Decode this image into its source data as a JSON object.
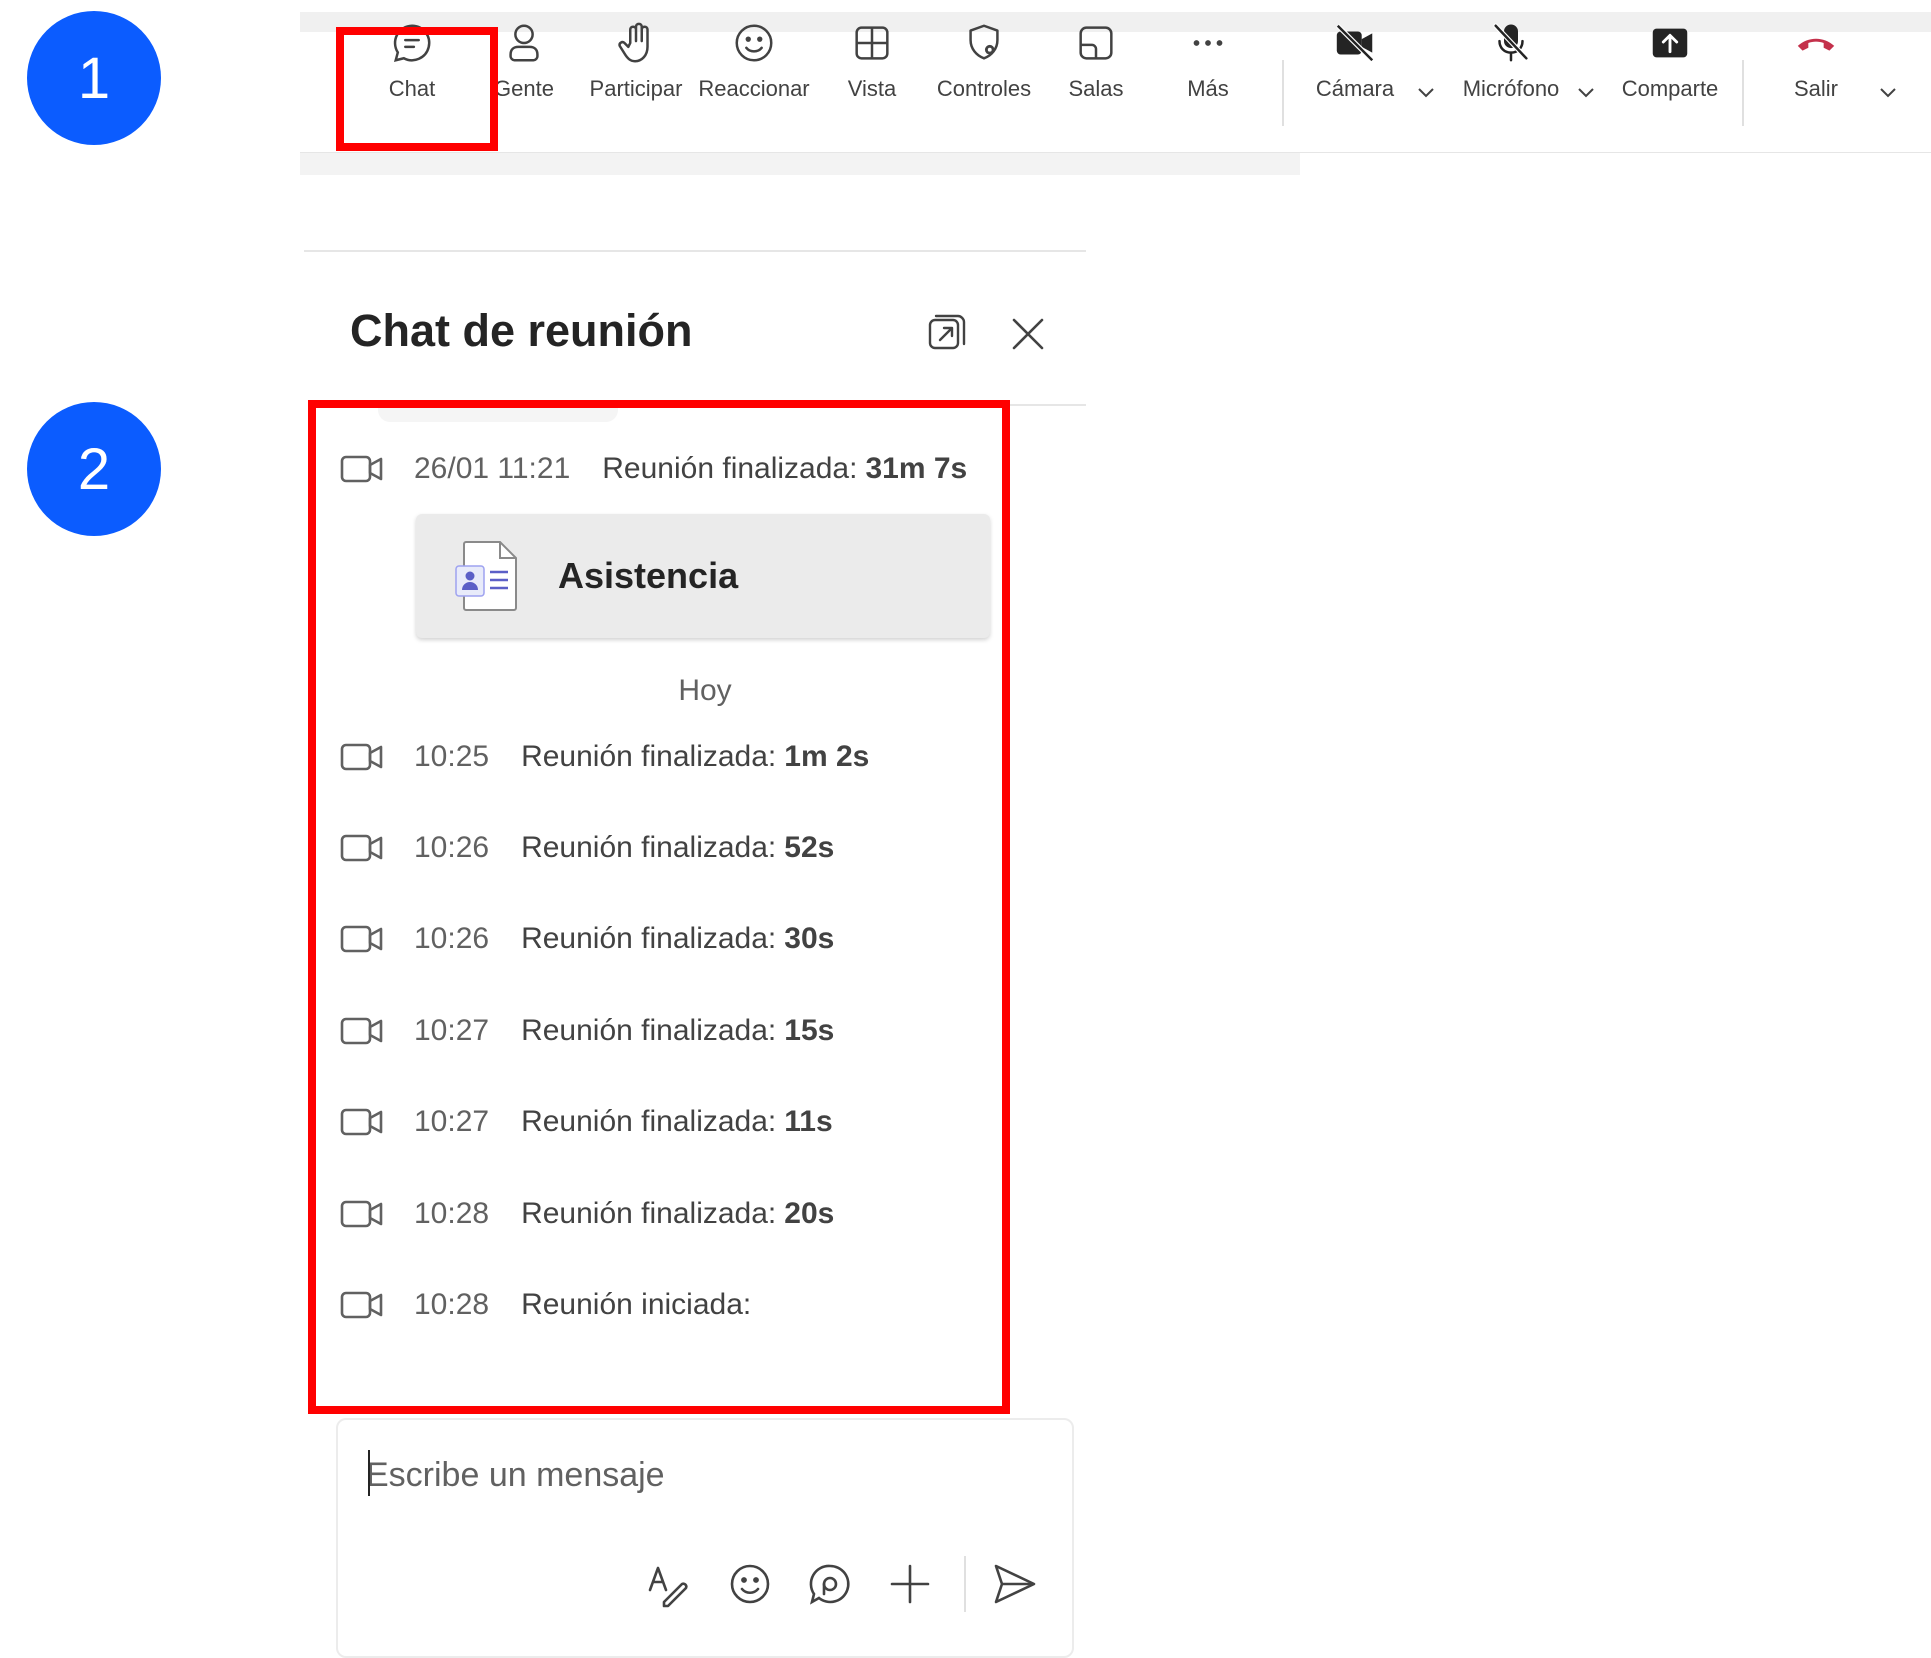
{
  "steps": [
    "1",
    "2"
  ],
  "toolbar": {
    "items": [
      {
        "label": "Chat",
        "icon": "chat-bubble-icon"
      },
      {
        "label": "Gente",
        "icon": "person-icon"
      },
      {
        "label": "Participar",
        "icon": "raise-hand-icon"
      },
      {
        "label": "Reaccionar",
        "icon": "smiley-icon"
      },
      {
        "label": "Vista",
        "icon": "grid-view-icon"
      },
      {
        "label": "Controles",
        "icon": "shield-gear-icon"
      },
      {
        "label": "Salas",
        "icon": "breakout-rooms-icon"
      },
      {
        "label": "Más",
        "icon": "more-icon"
      },
      {
        "label": "Cámara",
        "icon": "camera-off-icon"
      },
      {
        "label": "Micrófono",
        "icon": "mic-off-icon"
      },
      {
        "label": "Comparte",
        "icon": "share-screen-icon"
      },
      {
        "label": "Salir",
        "icon": "hang-up-icon"
      }
    ],
    "accent_color": "#5b5fc7",
    "hangup_color": "#c4314b"
  },
  "chat": {
    "title": "Chat de reunión",
    "first_event": {
      "time": "26/01 11:21",
      "text": "Reunión finalizada:",
      "duration": "31m 7s"
    },
    "attachment": {
      "name": "Asistencia",
      "icon": "attendance-report-icon"
    },
    "day_separator": "Hoy",
    "events": [
      {
        "time": "10:25",
        "text": "Reunión finalizada:",
        "duration": "1m 2s"
      },
      {
        "time": "10:26",
        "text": "Reunión finalizada:",
        "duration": "52s"
      },
      {
        "time": "10:26",
        "text": "Reunión finalizada:",
        "duration": "30s"
      },
      {
        "time": "10:27",
        "text": "Reunión finalizada:",
        "duration": "15s"
      },
      {
        "time": "10:27",
        "text": "Reunión finalizada:",
        "duration": "11s"
      },
      {
        "time": "10:28",
        "text": "Reunión finalizada:",
        "duration": "20s"
      },
      {
        "time": "10:28",
        "text": "Reunión iniciada:",
        "duration": ""
      }
    ]
  },
  "compose": {
    "placeholder": "Escribe un mensaje",
    "icons": [
      "format-icon",
      "emoji-icon",
      "loop-icon",
      "plus-icon",
      "send-icon"
    ]
  },
  "colors": {
    "badge": "#0b5cff",
    "highlight": "#ff0000"
  }
}
